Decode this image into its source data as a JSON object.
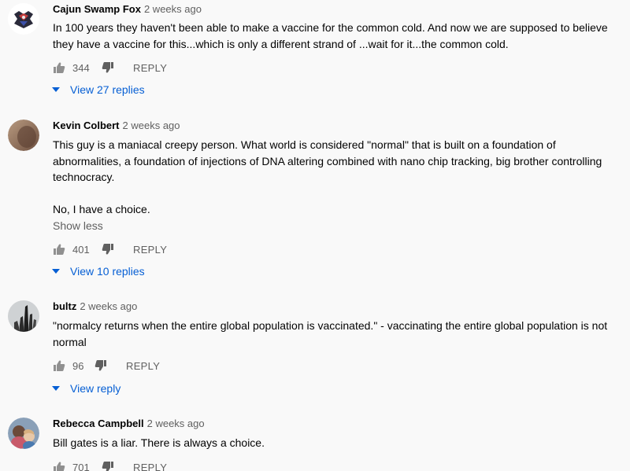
{
  "comments": [
    {
      "author": "Cajun Swamp Fox",
      "time": "2 weeks ago",
      "text": [
        "In 100 years they haven't been able to make a vaccine for the common cold.  And now we are supposed to believe they have a vaccine for this...which is only a different strand of ...wait for it...the common cold."
      ],
      "likes": "344",
      "reply_label": "REPLY",
      "replies_label": "View 27 replies",
      "avatar": "eagle-flag-avatar"
    },
    {
      "author": "Kevin Colbert",
      "time": "2 weeks ago",
      "text": [
        "This guy is a maniacal creepy person. What world is considered \"normal\" that is built on a foundation of abnormalities, a foundation of injections of DNA altering combined with nano chip tracking, big brother controlling technocracy.",
        "No, I have a choice."
      ],
      "show_less": "Show less",
      "likes": "401",
      "reply_label": "REPLY",
      "replies_label": "View 10 replies",
      "avatar": "brown-avatar"
    },
    {
      "author": "bultz",
      "time": "2 weeks ago",
      "text": [
        "\"normalcy returns when the entire global population is vaccinated.\" - vaccinating the entire global population is not normal"
      ],
      "likes": "96",
      "reply_label": "REPLY",
      "replies_label": "View reply",
      "avatar": "raised-hand-avatar"
    },
    {
      "author": "Rebecca Campbell",
      "time": "2 weeks ago",
      "text": [
        "Bill gates is a liar. There is always a choice."
      ],
      "likes": "701",
      "reply_label": "REPLY",
      "avatar": "photo-avatar"
    }
  ],
  "colors": {
    "background": "#f9f9f9",
    "link": "#065fd4",
    "secondary_text": "#606060",
    "primary_text": "#030303"
  }
}
